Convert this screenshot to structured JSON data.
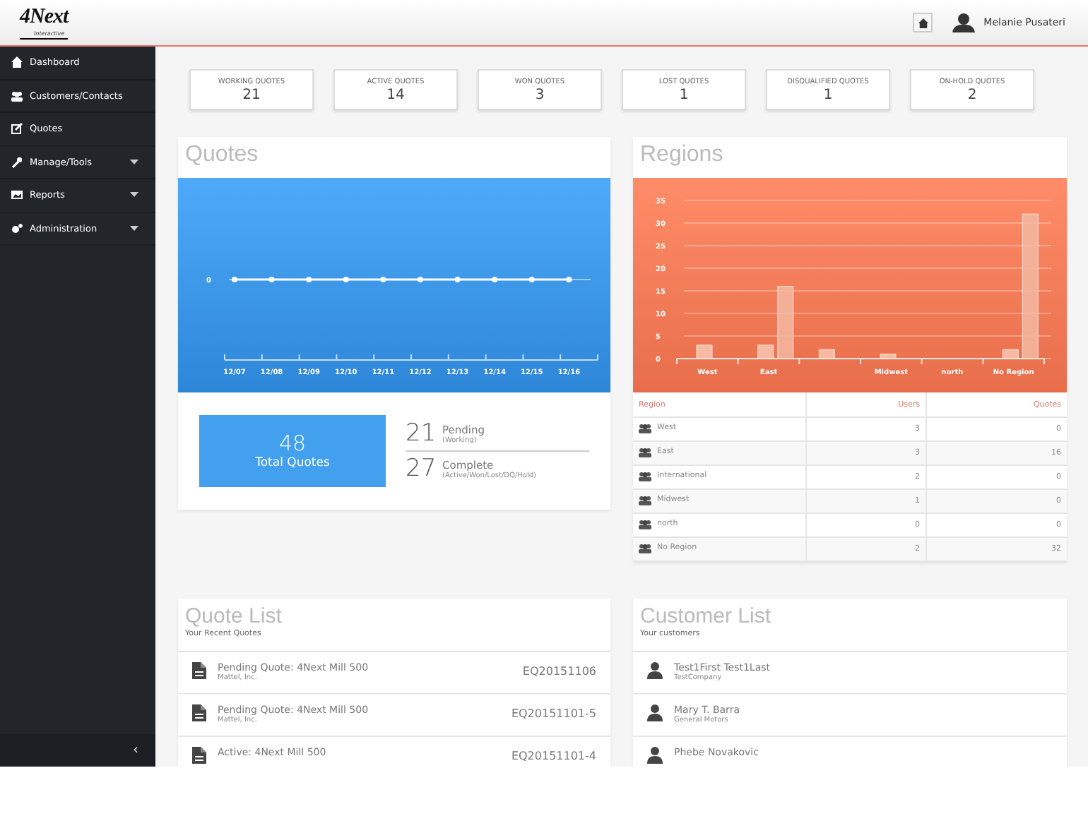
{
  "header": {
    "logo": "4Next",
    "logo_sub": "Interactive",
    "user_name": "Melanie Pusateri"
  },
  "sidebar": {
    "items": [
      {
        "label": "Dashboard",
        "submenu": false
      },
      {
        "label": "Customers/Contacts",
        "submenu": false
      },
      {
        "label": "Quotes",
        "submenu": false
      },
      {
        "label": "Manage/Tools",
        "submenu": true
      },
      {
        "label": "Reports",
        "submenu": true
      },
      {
        "label": "Administration",
        "submenu": true
      }
    ],
    "collapse": "‹"
  },
  "stats": [
    {
      "label": "WORKING QUOTES",
      "value": "21"
    },
    {
      "label": "ACTIVE QUOTES",
      "value": "14"
    },
    {
      "label": "WON QUOTES",
      "value": "3"
    },
    {
      "label": "LOST QUOTES",
      "value": "1"
    },
    {
      "label": "DISQUALIFIED QUOTES",
      "value": "1"
    },
    {
      "label": "ON-HOLD QUOTES",
      "value": "2"
    }
  ],
  "quotes_panel": {
    "title": "Quotes",
    "y_axis_label": "0",
    "x_labels": [
      "12/07",
      "12/08",
      "12/09",
      "12/10",
      "12/11",
      "12/12",
      "12/13",
      "12/14",
      "12/15",
      "12/16"
    ],
    "total": {
      "value": "48",
      "label": "Total Quotes"
    },
    "breakdown": [
      {
        "value": "21",
        "label": "Pending",
        "note": "(Working)"
      },
      {
        "value": "27",
        "label": "Complete",
        "note": "(Active/Won/Lost/DQ/Hold)"
      }
    ]
  },
  "regions_panel": {
    "title": "Regions",
    "chart_data": {
      "type": "bar",
      "categories": [
        "West",
        "East",
        null,
        "Midwest",
        "north",
        "No Region"
      ],
      "yticks": [
        0,
        5,
        10,
        15,
        20,
        25,
        30,
        35
      ],
      "ylim": [
        0,
        35
      ],
      "grid": true,
      "series": [
        {
          "color": "#f9c7b2",
          "values": [
            3,
            3,
            2,
            1,
            0,
            2
          ]
        },
        {
          "color": "#f3b8a2",
          "values": [
            0,
            16,
            0,
            0,
            0,
            32
          ]
        }
      ]
    },
    "table": {
      "columns": [
        "Region",
        "Users",
        "Quotes"
      ],
      "rows": [
        [
          "West",
          "3",
          "0"
        ],
        [
          "East",
          "3",
          "16"
        ],
        [
          "International",
          "2",
          "0"
        ],
        [
          "Midwest",
          "1",
          "0"
        ],
        [
          "north",
          "0",
          "0"
        ],
        [
          "No Region",
          "2",
          "32"
        ]
      ]
    }
  },
  "quote_list": {
    "title": "Quote List",
    "subtitle": "Your Recent Quotes",
    "items": [
      {
        "title": "Pending Quote: 4Next Mill 500",
        "company": "Mattel, Inc.",
        "number": "EQ20151106"
      },
      {
        "title": "Pending Quote: 4Next Mill 500",
        "company": "Mattel, Inc.",
        "number": "EQ20151101-5"
      },
      {
        "title": "Active: 4Next Mill 500",
        "number": "EQ20151101-4"
      }
    ]
  },
  "customer_list": {
    "title": "Customer List",
    "subtitle": "Your customers",
    "items": [
      {
        "name": "Test1First Test1Last",
        "company": "TestCompany"
      },
      {
        "name": "Mary T. Barra",
        "company": "General Motors"
      },
      {
        "name": "Phebe Novakovic"
      }
    ]
  }
}
